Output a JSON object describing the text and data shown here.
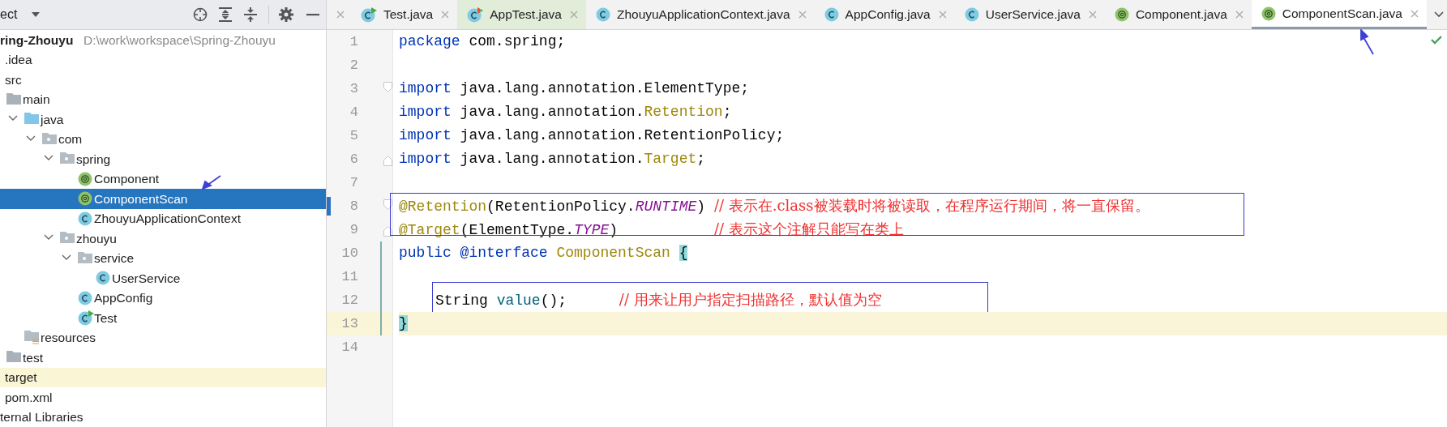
{
  "project_panel": {
    "title": "ect",
    "tree": [
      {
        "label": "ring-Zhouyu",
        "path": "D:\\work\\workspace\\Spring-Zhouyu",
        "selected": false,
        "highlighted": false,
        "children": [
          {
            "label": ".idea",
            "selected": false,
            "highlighted": false
          },
          {
            "label": "src",
            "selected": false,
            "highlighted": false,
            "children": [
              {
                "label": "main",
                "kind": "folder",
                "selected": false,
                "highlighted": false,
                "children": [
                  {
                    "label": "java",
                    "kind": "source-folder",
                    "expanded": true,
                    "selected": false,
                    "highlighted": false,
                    "children": [
                      {
                        "label": "com",
                        "kind": "package",
                        "expanded": true,
                        "selected": false,
                        "highlighted": false,
                        "children": [
                          {
                            "label": "spring",
                            "kind": "package",
                            "expanded": true,
                            "selected": false,
                            "highlighted": false,
                            "children": [
                              {
                                "label": "Component",
                                "kind": "annotation",
                                "selected": false,
                                "highlighted": false
                              },
                              {
                                "label": "ComponentScan",
                                "kind": "annotation",
                                "selected": true,
                                "highlighted": false
                              },
                              {
                                "label": "ZhouyuApplicationContext",
                                "kind": "class",
                                "selected": false,
                                "highlighted": false
                              }
                            ]
                          },
                          {
                            "label": "zhouyu",
                            "kind": "package",
                            "expanded": true,
                            "selected": false,
                            "highlighted": false,
                            "children": [
                              {
                                "label": "service",
                                "kind": "package",
                                "expanded": true,
                                "selected": false,
                                "highlighted": false,
                                "children": [
                                  {
                                    "label": "UserService",
                                    "kind": "class",
                                    "selected": false,
                                    "highlighted": false
                                  }
                                ]
                              },
                              {
                                "label": "AppConfig",
                                "kind": "class",
                                "selected": false,
                                "highlighted": false
                              },
                              {
                                "label": "Test",
                                "kind": "runnable-class",
                                "selected": false,
                                "highlighted": false
                              }
                            ]
                          }
                        ]
                      }
                    ]
                  },
                  {
                    "label": "resources",
                    "kind": "resources-folder",
                    "selected": false,
                    "highlighted": false
                  }
                ]
              },
              {
                "label": "test",
                "kind": "folder",
                "selected": false,
                "highlighted": false
              }
            ]
          },
          {
            "label": "target",
            "selected": false,
            "highlighted": true
          },
          {
            "label": "pom.xml",
            "selected": false,
            "highlighted": false
          }
        ]
      },
      {
        "label": "ternal Libraries",
        "selected": false,
        "highlighted": false
      }
    ]
  },
  "tabs": [
    {
      "label": "Test.java",
      "kind": "runnable-class",
      "selected": false,
      "test": false
    },
    {
      "label": "AppTest.java",
      "kind": "test-class",
      "selected": false,
      "test": true
    },
    {
      "label": "ZhouyuApplicationContext.java",
      "kind": "class",
      "selected": false,
      "test": false
    },
    {
      "label": "AppConfig.java",
      "kind": "class",
      "selected": false,
      "test": false
    },
    {
      "label": "UserService.java",
      "kind": "class",
      "selected": false,
      "test": false
    },
    {
      "label": "Component.java",
      "kind": "annotation",
      "selected": false,
      "test": false
    },
    {
      "label": "ComponentScan.java",
      "kind": "annotation",
      "selected": true,
      "test": false
    }
  ],
  "editor": {
    "lines": [
      {
        "number": "1",
        "current": false,
        "marked": false,
        "in_scope": false,
        "fold_start": false,
        "fold_end": false,
        "tokens": [
          {
            "text": "package",
            "kind": "keyword"
          },
          {
            "text": " com.spring;",
            "kind": "plain"
          }
        ]
      },
      {
        "number": "2",
        "current": false,
        "marked": false,
        "in_scope": false,
        "fold_start": false,
        "fold_end": false
      },
      {
        "number": "3",
        "current": false,
        "marked": false,
        "in_scope": false,
        "fold_start": true,
        "fold_end": false,
        "tokens": [
          {
            "text": "import",
            "kind": "keyword"
          },
          {
            "text": " java.lang.annotation.ElementType;",
            "kind": "plain"
          }
        ]
      },
      {
        "number": "4",
        "current": false,
        "marked": false,
        "in_scope": false,
        "fold_start": false,
        "fold_end": false,
        "tokens": [
          {
            "text": "import",
            "kind": "keyword"
          },
          {
            "text": " java.lang.annotation.",
            "kind": "plain"
          },
          {
            "text": "Retention",
            "kind": "annotation"
          },
          {
            "text": ";",
            "kind": "plain"
          }
        ]
      },
      {
        "number": "5",
        "current": false,
        "marked": false,
        "in_scope": false,
        "fold_start": false,
        "fold_end": false,
        "tokens": [
          {
            "text": "import",
            "kind": "keyword"
          },
          {
            "text": " java.lang.annotation.RetentionPolicy;",
            "kind": "plain"
          }
        ]
      },
      {
        "number": "6",
        "current": false,
        "marked": false,
        "in_scope": false,
        "fold_start": false,
        "fold_end": true,
        "tokens": [
          {
            "text": "import",
            "kind": "keyword"
          },
          {
            "text": " java.lang.annotation.",
            "kind": "plain"
          },
          {
            "text": "Target",
            "kind": "annotation"
          },
          {
            "text": ";",
            "kind": "plain"
          }
        ]
      },
      {
        "number": "7",
        "current": false,
        "marked": false,
        "in_scope": false,
        "fold_start": false,
        "fold_end": false
      },
      {
        "number": "8",
        "current": false,
        "marked": true,
        "in_scope": false,
        "fold_start": true,
        "fold_end": false,
        "tokens": [
          {
            "text": "@Retention",
            "kind": "annotation"
          },
          {
            "text": "(RetentionPolicy.",
            "kind": "plain"
          },
          {
            "text": "RUNTIME",
            "kind": "constant"
          },
          {
            "text": ") ",
            "kind": "plain"
          },
          {
            "text": "// 表示在.class被装载时将被读取，在程序运行期间，将一直保留。",
            "kind": "comment"
          }
        ]
      },
      {
        "number": "9",
        "current": false,
        "marked": false,
        "in_scope": false,
        "fold_start": false,
        "fold_end": true,
        "tokens": [
          {
            "text": "@Target",
            "kind": "annotation"
          },
          {
            "text": "(ElementType.",
            "kind": "plain"
          },
          {
            "text": "TYPE",
            "kind": "constant"
          },
          {
            "text": ")           ",
            "kind": "plain"
          },
          {
            "text": "// 表示这个注解只能写在类上",
            "kind": "comment"
          }
        ]
      },
      {
        "number": "10",
        "current": false,
        "marked": false,
        "in_scope": true,
        "fold_start": false,
        "fold_end": false,
        "tokens": [
          {
            "text": "public @interface",
            "kind": "keyword"
          },
          {
            "text": " ComponentScan ",
            "kind": "annotation"
          },
          {
            "text": "{",
            "kind": "brace"
          }
        ]
      },
      {
        "number": "11",
        "current": false,
        "marked": false,
        "in_scope": true,
        "fold_start": false,
        "fold_end": false
      },
      {
        "number": "12",
        "current": false,
        "marked": false,
        "in_scope": true,
        "fold_start": false,
        "fold_end": false,
        "indented": true,
        "boxed": true,
        "tokens": [
          {
            "text": "String ",
            "kind": "plain"
          },
          {
            "text": "value",
            "kind": "method"
          },
          {
            "text": "();      ",
            "kind": "plain"
          },
          {
            "text": "// 用来让用户指定扫描路径，默认值为空",
            "kind": "comment"
          }
        ]
      },
      {
        "number": "13",
        "current": true,
        "marked": false,
        "in_scope": true,
        "fold_start": false,
        "fold_end": false,
        "tokens": [
          {
            "text": "}",
            "kind": "brace"
          }
        ]
      },
      {
        "number": "14",
        "current": false,
        "marked": false,
        "in_scope": false,
        "fold_start": false,
        "fold_end": false
      }
    ]
  }
}
